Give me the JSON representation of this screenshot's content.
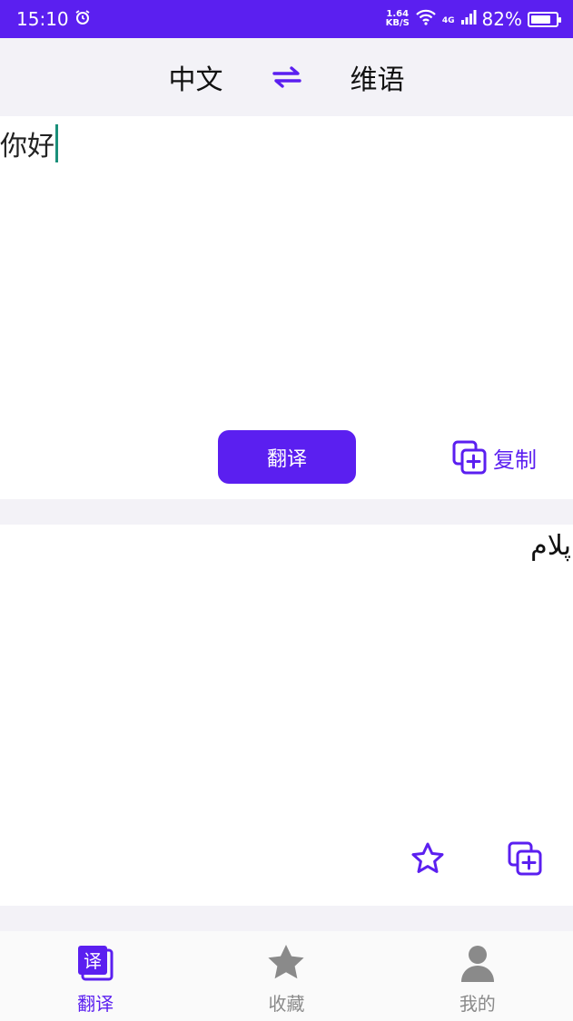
{
  "status_bar": {
    "time": "15:10",
    "net_speed_value": "1.64",
    "net_speed_unit": "KB/S",
    "network": "4G",
    "battery": "82%",
    "battery_level": 0.82
  },
  "lang_bar": {
    "source": "中文",
    "target": "维语"
  },
  "input": {
    "text": "你好"
  },
  "actions": {
    "translate_label": "翻译",
    "copy_label": "复制"
  },
  "output": {
    "text": "پلام"
  },
  "nav": {
    "translate_icon_char": "译",
    "items": [
      {
        "label": "翻译"
      },
      {
        "label": "收藏"
      },
      {
        "label": "我的"
      }
    ]
  },
  "colors": {
    "accent": "#5b1ff0",
    "caret": "#1a8f7a"
  }
}
